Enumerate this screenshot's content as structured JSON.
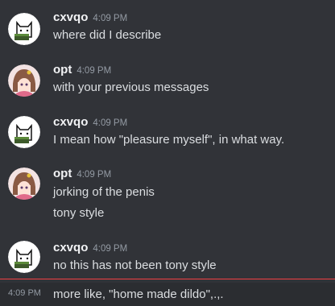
{
  "messages": [
    {
      "username": "cxvqo",
      "time": "4:09 PM",
      "avatar": "cat-avatar",
      "lines": [
        "where did I describe"
      ]
    },
    {
      "username": "opt",
      "time": "4:09 PM",
      "avatar": "anime-girl-avatar",
      "lines": [
        "with your previous messages"
      ]
    },
    {
      "username": "cxvqo",
      "time": "4:09 PM",
      "avatar": "cat-avatar",
      "lines": [
        "I mean how \"pleasure myself\", in what way."
      ]
    },
    {
      "username": "opt",
      "time": "4:09 PM",
      "avatar": "anime-girl-avatar",
      "lines": [
        "jorking of the penis",
        "tony style"
      ]
    },
    {
      "username": "cxvqo",
      "time": "4:09 PM",
      "avatar": "cat-avatar",
      "lines": [
        "no this has not been tony style"
      ]
    }
  ],
  "followup": {
    "time": "4:09 PM",
    "text": "more like, \"home made dildo\",.,."
  },
  "colors": {
    "background": "#313338",
    "new_divider": "#f23f43",
    "hover_row": "#2b2d31"
  }
}
